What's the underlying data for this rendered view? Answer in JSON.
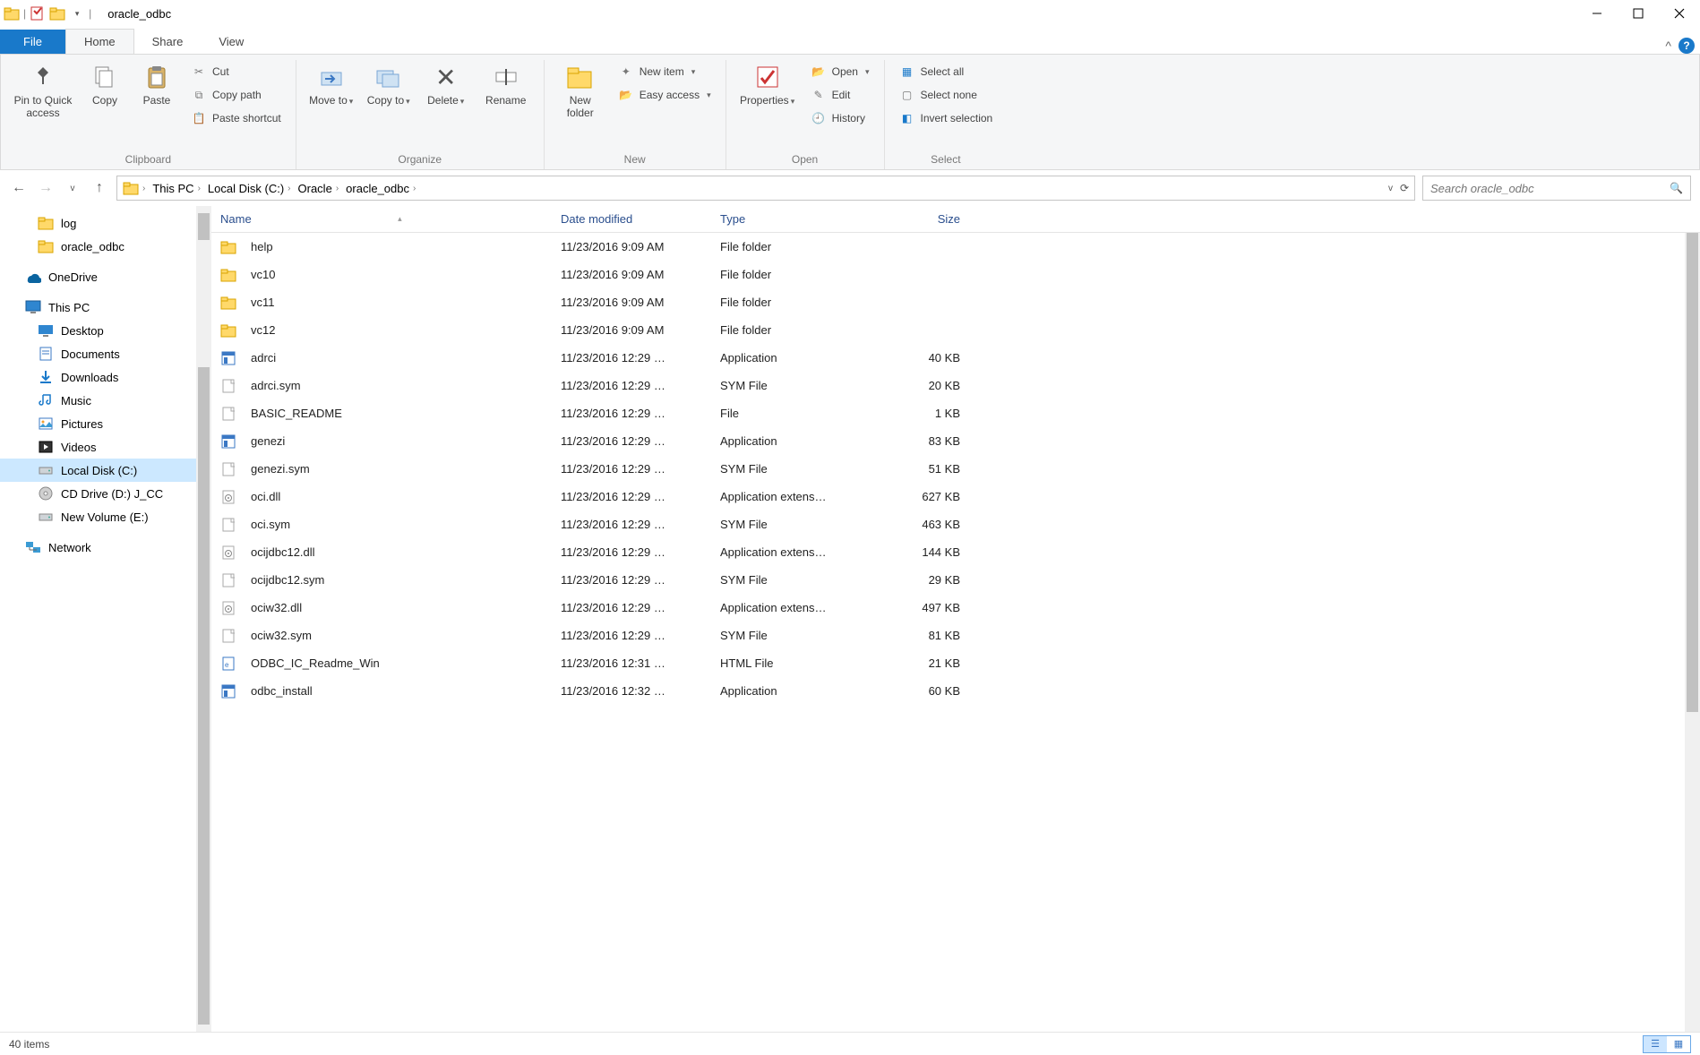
{
  "window": {
    "title": "oracle_odbc"
  },
  "tabs": {
    "file": "File",
    "home": "Home",
    "share": "Share",
    "view": "View"
  },
  "ribbon": {
    "clipboard": {
      "label": "Clipboard",
      "pin": "Pin to Quick access",
      "copy": "Copy",
      "paste": "Paste",
      "cut": "Cut",
      "copypath": "Copy path",
      "pasteshortcut": "Paste shortcut"
    },
    "organize": {
      "label": "Organize",
      "moveto": "Move to",
      "copyto": "Copy to",
      "delete": "Delete",
      "rename": "Rename"
    },
    "new": {
      "label": "New",
      "newfolder": "New folder",
      "newitem": "New item",
      "easyaccess": "Easy access"
    },
    "open": {
      "label": "Open",
      "properties": "Properties",
      "open": "Open",
      "edit": "Edit",
      "history": "History"
    },
    "select": {
      "label": "Select",
      "selectall": "Select all",
      "selectnone": "Select none",
      "invert": "Invert selection"
    }
  },
  "breadcrumbs": [
    "This PC",
    "Local Disk (C:)",
    "Oracle",
    "oracle_odbc"
  ],
  "search": {
    "placeholder": "Search oracle_odbc"
  },
  "nav": {
    "quick": [
      {
        "label": "log",
        "icon": "folder"
      },
      {
        "label": "oracle_odbc",
        "icon": "folder"
      }
    ],
    "onedrive": "OneDrive",
    "thispc": "This PC",
    "thispc_items": [
      {
        "label": "Desktop",
        "icon": "desktop"
      },
      {
        "label": "Documents",
        "icon": "documents"
      },
      {
        "label": "Downloads",
        "icon": "downloads"
      },
      {
        "label": "Music",
        "icon": "music"
      },
      {
        "label": "Pictures",
        "icon": "pictures"
      },
      {
        "label": "Videos",
        "icon": "videos"
      },
      {
        "label": "Local Disk (C:)",
        "icon": "disk",
        "selected": true
      },
      {
        "label": "CD Drive (D:) J_CC",
        "icon": "cd"
      },
      {
        "label": "New Volume (E:)",
        "icon": "disk"
      }
    ],
    "network": "Network"
  },
  "columns": {
    "name": "Name",
    "date": "Date modified",
    "type": "Type",
    "size": "Size"
  },
  "files": [
    {
      "name": "help",
      "date": "11/23/2016 9:09 AM",
      "type": "File folder",
      "size": "",
      "icon": "folder"
    },
    {
      "name": "vc10",
      "date": "11/23/2016 9:09 AM",
      "type": "File folder",
      "size": "",
      "icon": "folder"
    },
    {
      "name": "vc11",
      "date": "11/23/2016 9:09 AM",
      "type": "File folder",
      "size": "",
      "icon": "folder"
    },
    {
      "name": "vc12",
      "date": "11/23/2016 9:09 AM",
      "type": "File folder",
      "size": "",
      "icon": "folder"
    },
    {
      "name": "adrci",
      "date": "11/23/2016 12:29 …",
      "type": "Application",
      "size": "40 KB",
      "icon": "app"
    },
    {
      "name": "adrci.sym",
      "date": "11/23/2016 12:29 …",
      "type": "SYM File",
      "size": "20 KB",
      "icon": "file"
    },
    {
      "name": "BASIC_README",
      "date": "11/23/2016 12:29 …",
      "type": "File",
      "size": "1 KB",
      "icon": "file"
    },
    {
      "name": "genezi",
      "date": "11/23/2016 12:29 …",
      "type": "Application",
      "size": "83 KB",
      "icon": "app"
    },
    {
      "name": "genezi.sym",
      "date": "11/23/2016 12:29 …",
      "type": "SYM File",
      "size": "51 KB",
      "icon": "file"
    },
    {
      "name": "oci.dll",
      "date": "11/23/2016 12:29 …",
      "type": "Application extens…",
      "size": "627 KB",
      "icon": "dll"
    },
    {
      "name": "oci.sym",
      "date": "11/23/2016 12:29 …",
      "type": "SYM File",
      "size": "463 KB",
      "icon": "file"
    },
    {
      "name": "ocijdbc12.dll",
      "date": "11/23/2016 12:29 …",
      "type": "Application extens…",
      "size": "144 KB",
      "icon": "dll"
    },
    {
      "name": "ocijdbc12.sym",
      "date": "11/23/2016 12:29 …",
      "type": "SYM File",
      "size": "29 KB",
      "icon": "file"
    },
    {
      "name": "ociw32.dll",
      "date": "11/23/2016 12:29 …",
      "type": "Application extens…",
      "size": "497 KB",
      "icon": "dll"
    },
    {
      "name": "ociw32.sym",
      "date": "11/23/2016 12:29 …",
      "type": "SYM File",
      "size": "81 KB",
      "icon": "file"
    },
    {
      "name": "ODBC_IC_Readme_Win",
      "date": "11/23/2016 12:31 …",
      "type": "HTML File",
      "size": "21 KB",
      "icon": "html"
    },
    {
      "name": "odbc_install",
      "date": "11/23/2016 12:32 …",
      "type": "Application",
      "size": "60 KB",
      "icon": "app"
    }
  ],
  "status": {
    "items": "40 items"
  }
}
